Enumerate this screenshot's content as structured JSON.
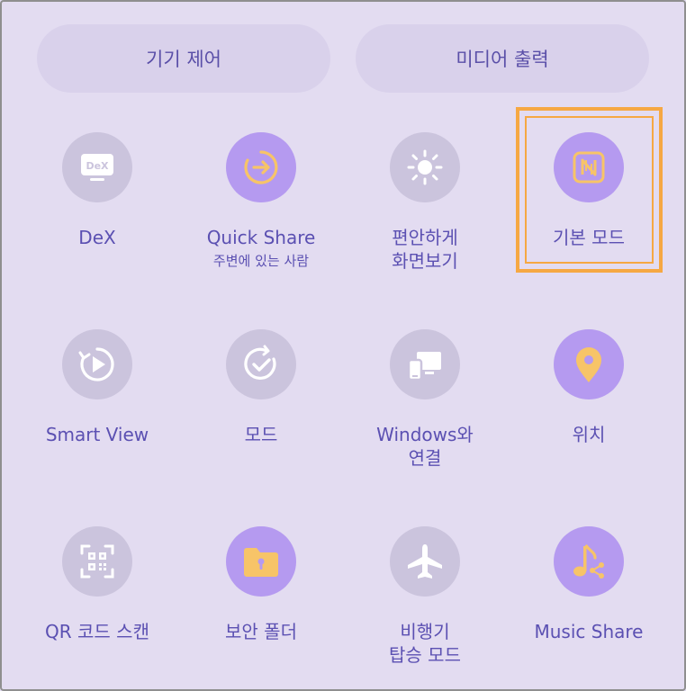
{
  "top_buttons": {
    "device_control": "기기 제어",
    "media_output": "미디어 출력"
  },
  "tiles": [
    {
      "label": "DeX",
      "sub": "",
      "icon": "dex-icon",
      "active": false
    },
    {
      "label": "Quick Share",
      "sub": "주변에 있는 사람",
      "icon": "quick-share-icon",
      "active": true
    },
    {
      "label": "편안하게",
      "label2": "화면보기",
      "icon": "eye-comfort-icon",
      "active": false
    },
    {
      "label": "기본 모드",
      "icon": "nfc-icon",
      "active": true
    },
    {
      "label": "Smart View",
      "icon": "smart-view-icon",
      "active": false
    },
    {
      "label": "모드",
      "icon": "modes-icon",
      "active": false
    },
    {
      "label": "Windows와",
      "label2": "연결",
      "icon": "link-to-windows-icon",
      "active": false
    },
    {
      "label": "위치",
      "icon": "location-pin-icon",
      "active": true
    },
    {
      "label": "QR 코드 스캔",
      "icon": "qr-scan-icon",
      "active": false
    },
    {
      "label": "보안 폴더",
      "icon": "secure-folder-icon",
      "active": true
    },
    {
      "label": "비행기",
      "label2": "탑승 모드",
      "icon": "airplane-icon",
      "active": false
    },
    {
      "label": "Music Share",
      "icon": "music-share-icon",
      "active": true
    }
  ],
  "colors": {
    "background": "#e3dcf1",
    "active_circle": "#b59af0",
    "inactive_circle": "#cbc4dd",
    "active_glyph": "#f7c468",
    "highlight": "#f6a843"
  }
}
